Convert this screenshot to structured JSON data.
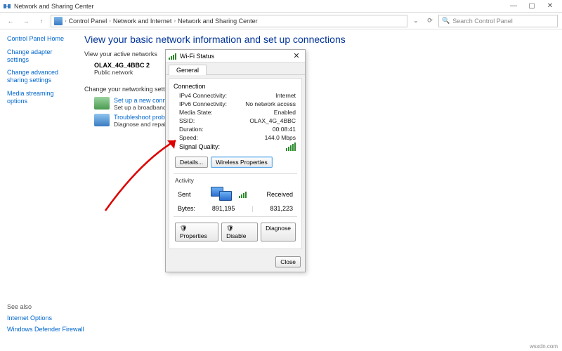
{
  "window": {
    "title": "Network and Sharing Center",
    "min": "—",
    "max": "▢",
    "close": "✕"
  },
  "addr": {
    "back": "←",
    "fwd": "→",
    "up": "↑",
    "drop": "⌄",
    "refresh": "⟳",
    "root": "Control Panel",
    "lvl2": "Network and Internet",
    "lvl3": "Network and Sharing Center",
    "sep": "›",
    "search_placeholder": "Search Control Panel",
    "search_icon": "🔍"
  },
  "sidebar": {
    "home": "Control Panel Home",
    "adapter": "Change adapter settings",
    "advanced": "Change advanced sharing settings",
    "media": "Media streaming options"
  },
  "page": {
    "heading": "View your basic network information and set up connections",
    "active_label": "View your active networks",
    "net_name": "OLAX_4G_4BBC 2",
    "net_type": "Public network",
    "change_label": "Change your networking settings",
    "task1_title": "Set up a new connection or",
    "task1_desc": "Set up a broadband, dial-up,",
    "task2_title": "Troubleshoot problems",
    "task2_desc": "Diagnose and repair network"
  },
  "dialog": {
    "title": "Wi-Fi Status",
    "tab": "General",
    "group": "Connection",
    "rows": {
      "ipv4_k": "IPv4 Connectivity:",
      "ipv4_v": "Internet",
      "ipv6_k": "IPv6 Connectivity:",
      "ipv6_v": "No network access",
      "media_k": "Media State:",
      "media_v": "Enabled",
      "ssid_k": "SSID:",
      "ssid_v": "OLAX_4G_4BBC",
      "dur_k": "Duration:",
      "dur_v": "00:08:41",
      "speed_k": "Speed:",
      "speed_v": "144.0 Mbps",
      "sig_k": "Signal Quality:"
    },
    "details_btn": "Details...",
    "wireless_btn": "Wireless Properties",
    "activity_hdr": "Activity",
    "sent": "Sent",
    "recv": "Received",
    "bytes_k": "Bytes:",
    "bytes_sent": "891,195",
    "bytes_recv": "831,223",
    "props_btn": "Properties",
    "disable_btn": "Disable",
    "diag_btn": "Diagnose",
    "close_btn": "Close",
    "x": "✕"
  },
  "seealso": {
    "hdr": "See also",
    "inet": "Internet Options",
    "fw": "Windows Defender Firewall"
  },
  "footer": "wsxdn.com"
}
